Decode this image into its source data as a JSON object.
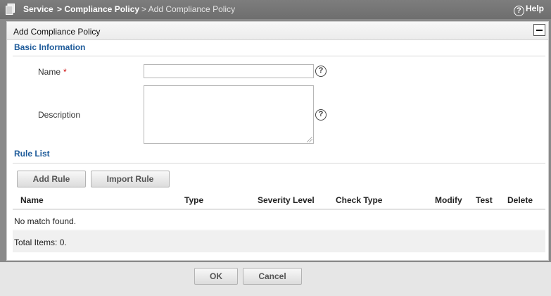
{
  "breadcrumb": {
    "service": "Service",
    "compliance_policy": "> Compliance Policy",
    "current": "> Add Compliance Policy"
  },
  "help": {
    "icon": "help-circle-icon",
    "label": "Help"
  },
  "panel": {
    "title": "Add Compliance Policy",
    "collapse_icon": "minus-icon"
  },
  "basic_info": {
    "title": "Basic Information",
    "name_label": "Name",
    "required_mark": "*",
    "name_value": "",
    "description_label": "Description",
    "description_value": "",
    "help_glyph": "?"
  },
  "rule_list": {
    "title": "Rule List",
    "add_rule": "Add Rule",
    "import_rule": "Import Rule",
    "columns": [
      "Name",
      "Type",
      "Severity Level",
      "Check Type",
      "Modify",
      "Test",
      "Delete"
    ],
    "empty_text": "No match found.",
    "total_text": "Total Items: 0."
  },
  "footer": {
    "ok": "OK",
    "cancel": "Cancel"
  },
  "colors": {
    "section_title": "#1e5b9a",
    "required": "#cc0000",
    "topbar": "#767676"
  }
}
